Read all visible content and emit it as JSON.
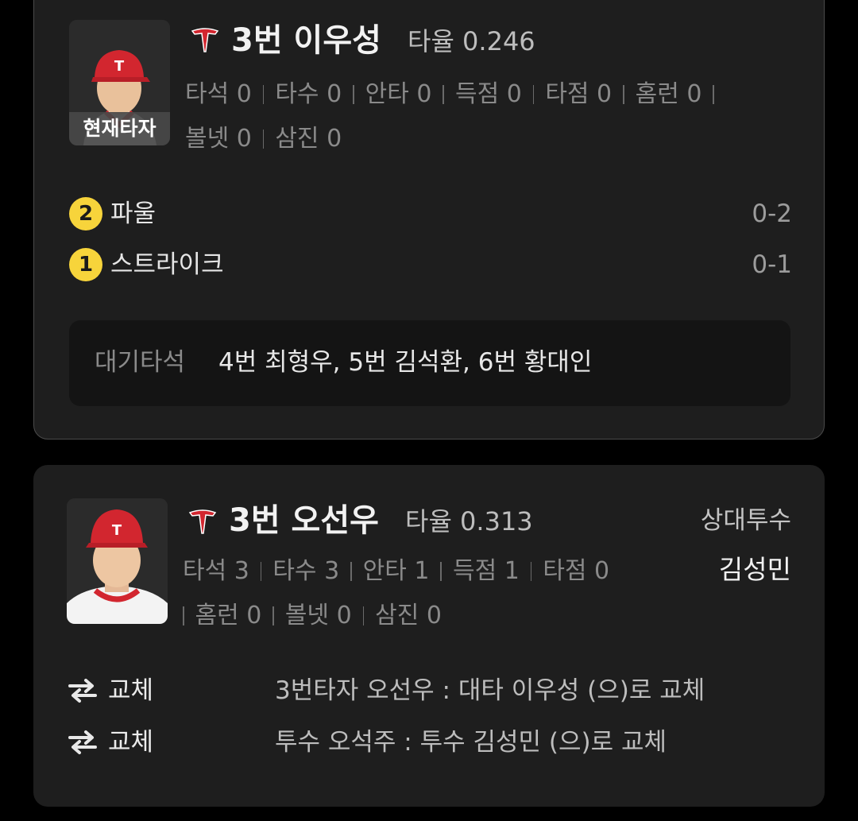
{
  "current_batter": {
    "badge": "현재타자",
    "name": "3번 이우성",
    "avg": "타율 0.246",
    "stats": [
      "타석 0",
      "타수 0",
      "안타 0",
      "득점 0",
      "타점 0",
      "홈런 0",
      "볼넷 0",
      "삼진 0"
    ],
    "pitches": [
      {
        "num": "2",
        "label": "파울",
        "count": "0-2"
      },
      {
        "num": "1",
        "label": "스트라이크",
        "count": "0-1"
      }
    ],
    "on_deck_label": "대기타석",
    "on_deck": "4번 최형우, 5번 김석환, 6번 황대인"
  },
  "previous_batter": {
    "name": "3번 오선우",
    "avg": "타율 0.313",
    "stats": [
      "타석 3",
      "타수 3",
      "안타 1",
      "득점 1",
      "타점 0",
      "홈런 0",
      "볼넷 0",
      "삼진 0"
    ],
    "opponent_pitcher_label": "상대투수",
    "opponent_pitcher": "김성민",
    "substitutions": [
      {
        "label": "교체",
        "desc": "3번타자 오선우 : 대타 이우성 (으)로 교체"
      },
      {
        "label": "교체",
        "desc": "투수 오석주 : 투수 김성민 (으)로 교체"
      }
    ]
  },
  "colors": {
    "card_bg": "#1e1e1e",
    "pitch_badge": "#f7d43b",
    "team_red": "#d2262f"
  }
}
